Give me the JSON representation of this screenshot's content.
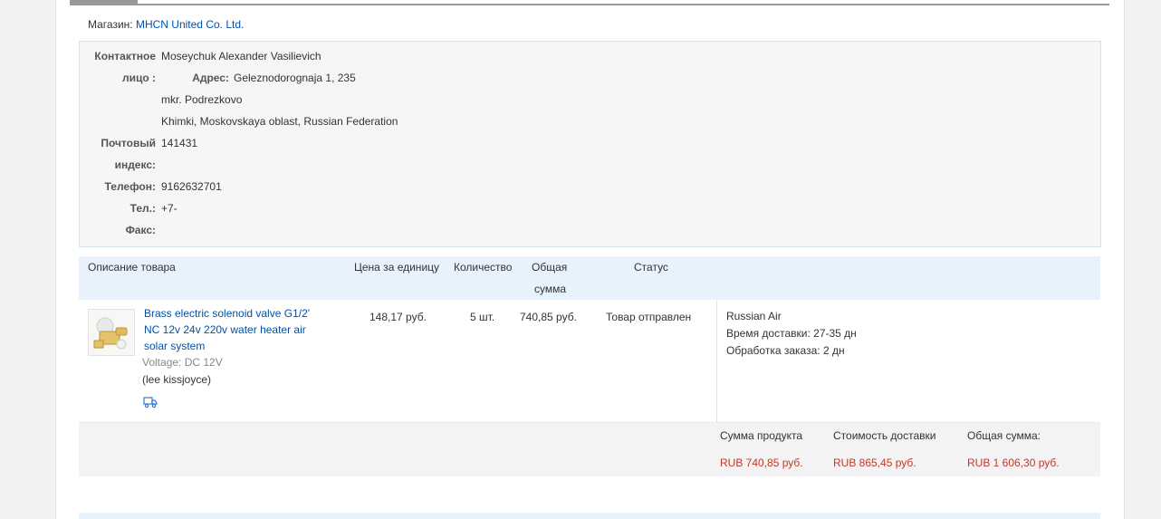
{
  "store": {
    "label": "Магазин:",
    "name": "MHCN United Co. Ltd."
  },
  "address": {
    "contact_label_1": "Контактное",
    "contact_label_2": "лицо :",
    "contact_value": "Moseychuk Alexander Vasilievich",
    "address_label": "Адрес:",
    "address_line1": "Geleznodorognaja 1, 235",
    "address_line2": "mkr. Podrezkovo",
    "address_line3": "Khimki, Moskovskaya oblast, Russian Federation",
    "postal_label_1": "Почтовый",
    "postal_label_2": "индекс:",
    "postal_value": "141431",
    "phone_label": "Телефон:",
    "phone_value": "9162632701",
    "tel_label": "Тел.:",
    "tel_value": "+7-",
    "fax_label": "Факс:"
  },
  "table_header": {
    "description": "Описание товара",
    "unit_price": "Цена за единицу",
    "quantity": "Количество",
    "total_1": "Общая",
    "total_2": "сумма",
    "status": "Статус"
  },
  "product": {
    "title": "Brass electric solenoid valve G1/2' NC 12v 24v 220v water heater air solar system",
    "title_l1": "Brass electric solenoid valve G1/2'",
    "title_l2": "NC 12v 24v 220v water heater air",
    "title_l3": "solar system",
    "variant": "Voltage: DC 12V",
    "seller": "(lee kissjoyce)",
    "unit_price": "148,17 руб.",
    "quantity": "5 шт.",
    "total": "740,85 руб.",
    "status": "Товар отправлен",
    "icon": "truck-icon"
  },
  "shipping": {
    "method": "Russian Air",
    "delivery_label": "Время доставки:",
    "delivery_value": "27-35 дн",
    "processing_label": "Обработка заказа:",
    "processing_value": "2 дн"
  },
  "summary": {
    "product_sum_label": "Сумма продукта",
    "product_sum_value": "RUB 740,85 руб.",
    "shipping_cost_label": "Стоимость доставки",
    "shipping_cost_value": "RUB 865,45 руб.",
    "total_label": "Общая сумма:",
    "total_value": "RUB 1 606,30 руб."
  },
  "colors": {
    "link": "#0051a9",
    "price_red": "#c0392b",
    "header_bg": "#e8f2fc"
  }
}
